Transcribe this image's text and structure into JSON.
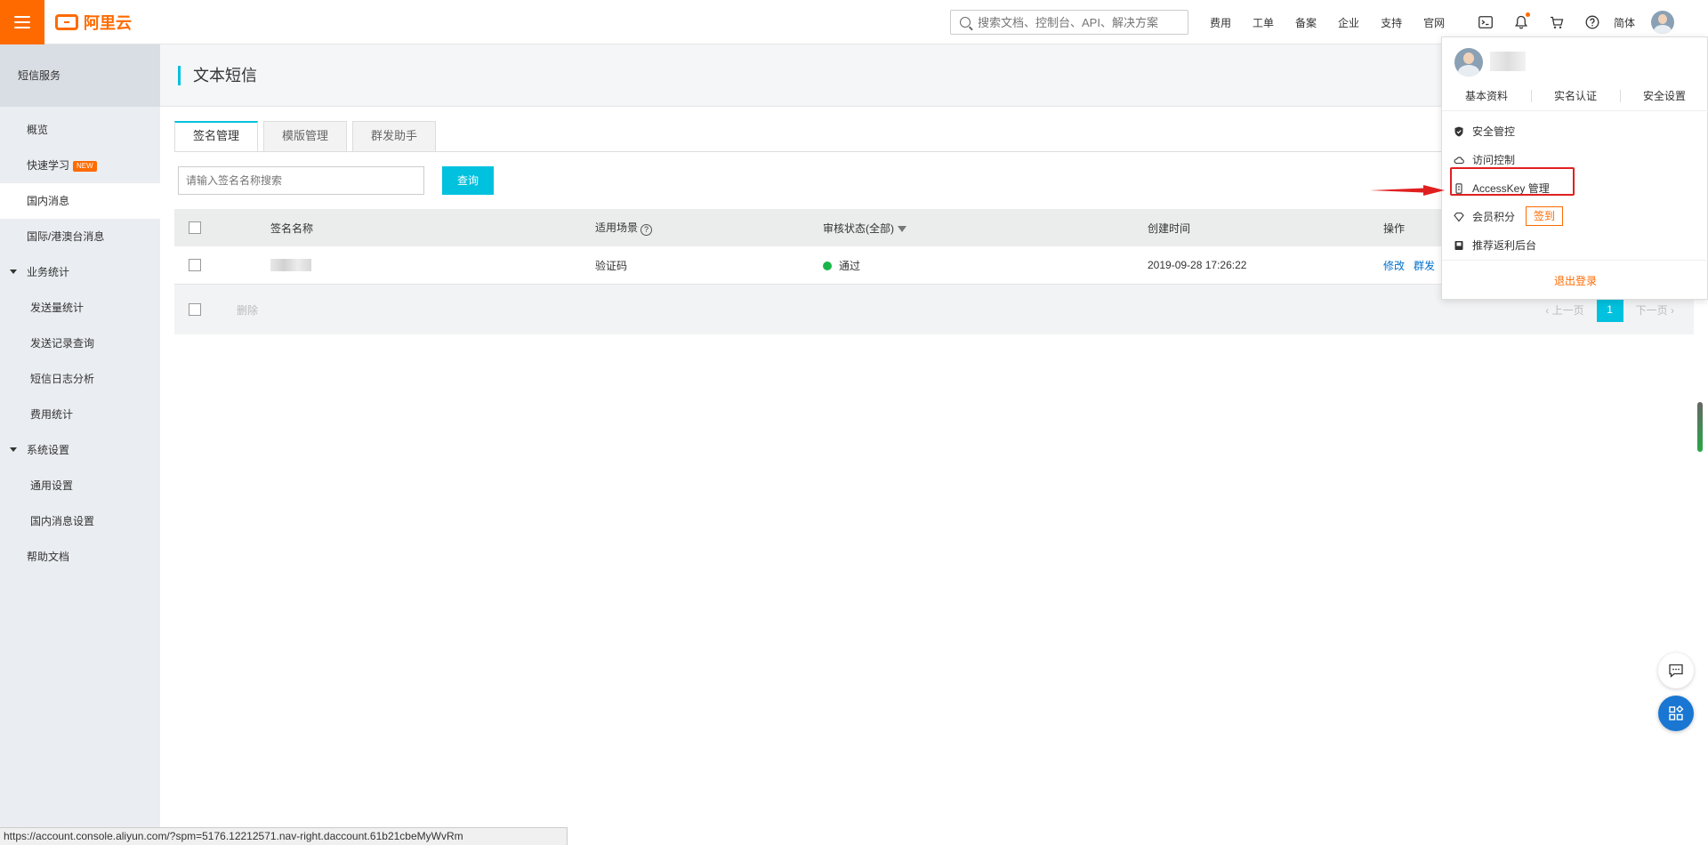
{
  "header": {
    "brand": "阿里云",
    "search_placeholder": "搜索文档、控制台、API、解决方案",
    "nav_links": [
      "费用",
      "工单",
      "备案",
      "企业",
      "支持",
      "官网"
    ],
    "lang": "简体"
  },
  "sidebar": {
    "title": "短信服务",
    "items": [
      {
        "label": "概览"
      },
      {
        "label": "快速学习",
        "badge": "NEW"
      },
      {
        "label": "国内消息"
      },
      {
        "label": "国际/港澳台消息"
      },
      {
        "label": "业务统计"
      },
      {
        "label": "发送量统计"
      },
      {
        "label": "发送记录查询"
      },
      {
        "label": "短信日志分析"
      },
      {
        "label": "费用统计"
      },
      {
        "label": "系统设置"
      },
      {
        "label": "通用设置"
      },
      {
        "label": "国内消息设置"
      },
      {
        "label": "帮助文档"
      }
    ]
  },
  "main": {
    "title": "文本短信",
    "tabs": [
      {
        "label": "签名管理"
      },
      {
        "label": "模版管理"
      },
      {
        "label": "群发助手"
      }
    ],
    "search": {
      "placeholder": "请输入签名名称搜索",
      "button": "查询"
    },
    "table": {
      "columns": [
        "签名名称",
        "适用场景",
        "审核状态(全部)",
        "创建时间",
        "操作"
      ],
      "rows": [
        {
          "scene": "验证码",
          "status": "通过",
          "created": "2019-09-28 17:26:22",
          "ops": [
            "修改",
            "群发"
          ]
        }
      ],
      "delete_label": "删除",
      "pager": {
        "prev": "上一页",
        "current": "1",
        "next": "下一页"
      }
    }
  },
  "user_menu": {
    "links": [
      "基本资料",
      "实名认证",
      "安全设置"
    ],
    "items": [
      {
        "label": "安全管控",
        "icon": "shield-icon"
      },
      {
        "label": "访问控制",
        "icon": "cloud-icon"
      },
      {
        "label": "AccessKey 管理",
        "icon": "key-icon"
      },
      {
        "label": "会员积分",
        "icon": "diamond-icon",
        "action": "签到"
      },
      {
        "label": "推荐返利后台",
        "icon": "book-icon"
      }
    ],
    "logout": "退出登录"
  },
  "status_url": "https://account.console.aliyun.com/?spm=5176.12212571.nav-right.daccount.61b21cbeMyWvRm",
  "colors": {
    "brand": "#ff6a00",
    "accent": "#00c1de",
    "highlight": "#e02020",
    "success": "#1ab54a",
    "link": "#0070cc"
  }
}
